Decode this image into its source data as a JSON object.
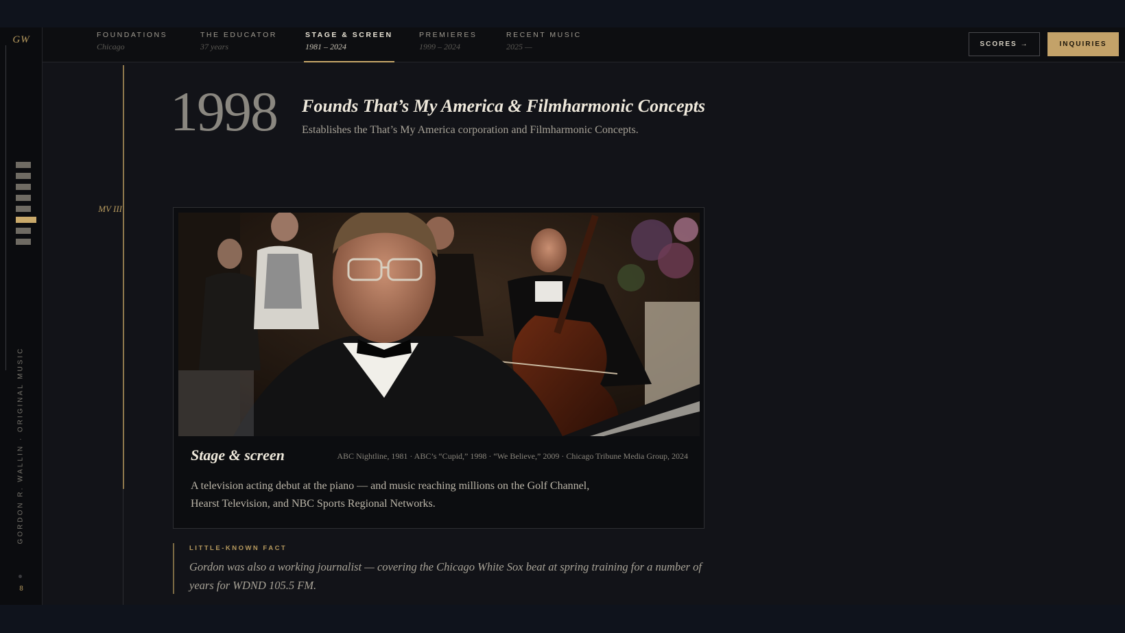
{
  "rail": {
    "logo": "GW",
    "vertical_text": "GORDON R. WALLIN · ORIGINAL MUSIC",
    "page_number": "8",
    "movement_count": 8,
    "active_movement": 6
  },
  "nav": {
    "items": [
      {
        "title": "FOUNDATIONS",
        "subtitle": "Chicago"
      },
      {
        "title": "THE EDUCATOR",
        "subtitle": "37 years"
      },
      {
        "title": "STAGE & SCREEN",
        "subtitle": "1981 – 2024"
      },
      {
        "title": "PREMIERES",
        "subtitle": "1999 – 2024"
      },
      {
        "title": "RECENT MUSIC",
        "subtitle": "2025 —"
      }
    ],
    "active_index": 2,
    "scores_label": "SCORES →",
    "inquiries_label": "INQUIRIES"
  },
  "event": {
    "year": "1998",
    "title": "Founds That’s My America & Filmharmonic Concepts",
    "description": "Establishes the That’s My America corporation and Filmharmonic Concepts.",
    "movement_label": "MV III"
  },
  "card": {
    "title": "Stage & screen",
    "credits": "ABC Nightline, 1981 · ABC’s “Cupid,” 1998 · “We Believe,” 2009 · Chicago Tribune Media Group, 2024",
    "body": "A television acting debut at the piano — and music reaching millions on the Golf Channel, Hearst Television, and NBC Sports Regional Networks."
  },
  "fact": {
    "label": "LITTLE-KNOWN FACT",
    "text": "Gordon was also a working journalist — covering the Chicago White Sox beat at spring training for a number of years for WDND 105.5 FM."
  },
  "colors": {
    "accent_gold": "#c3a269",
    "background": "#121318",
    "rail": "#0b0c0f"
  }
}
